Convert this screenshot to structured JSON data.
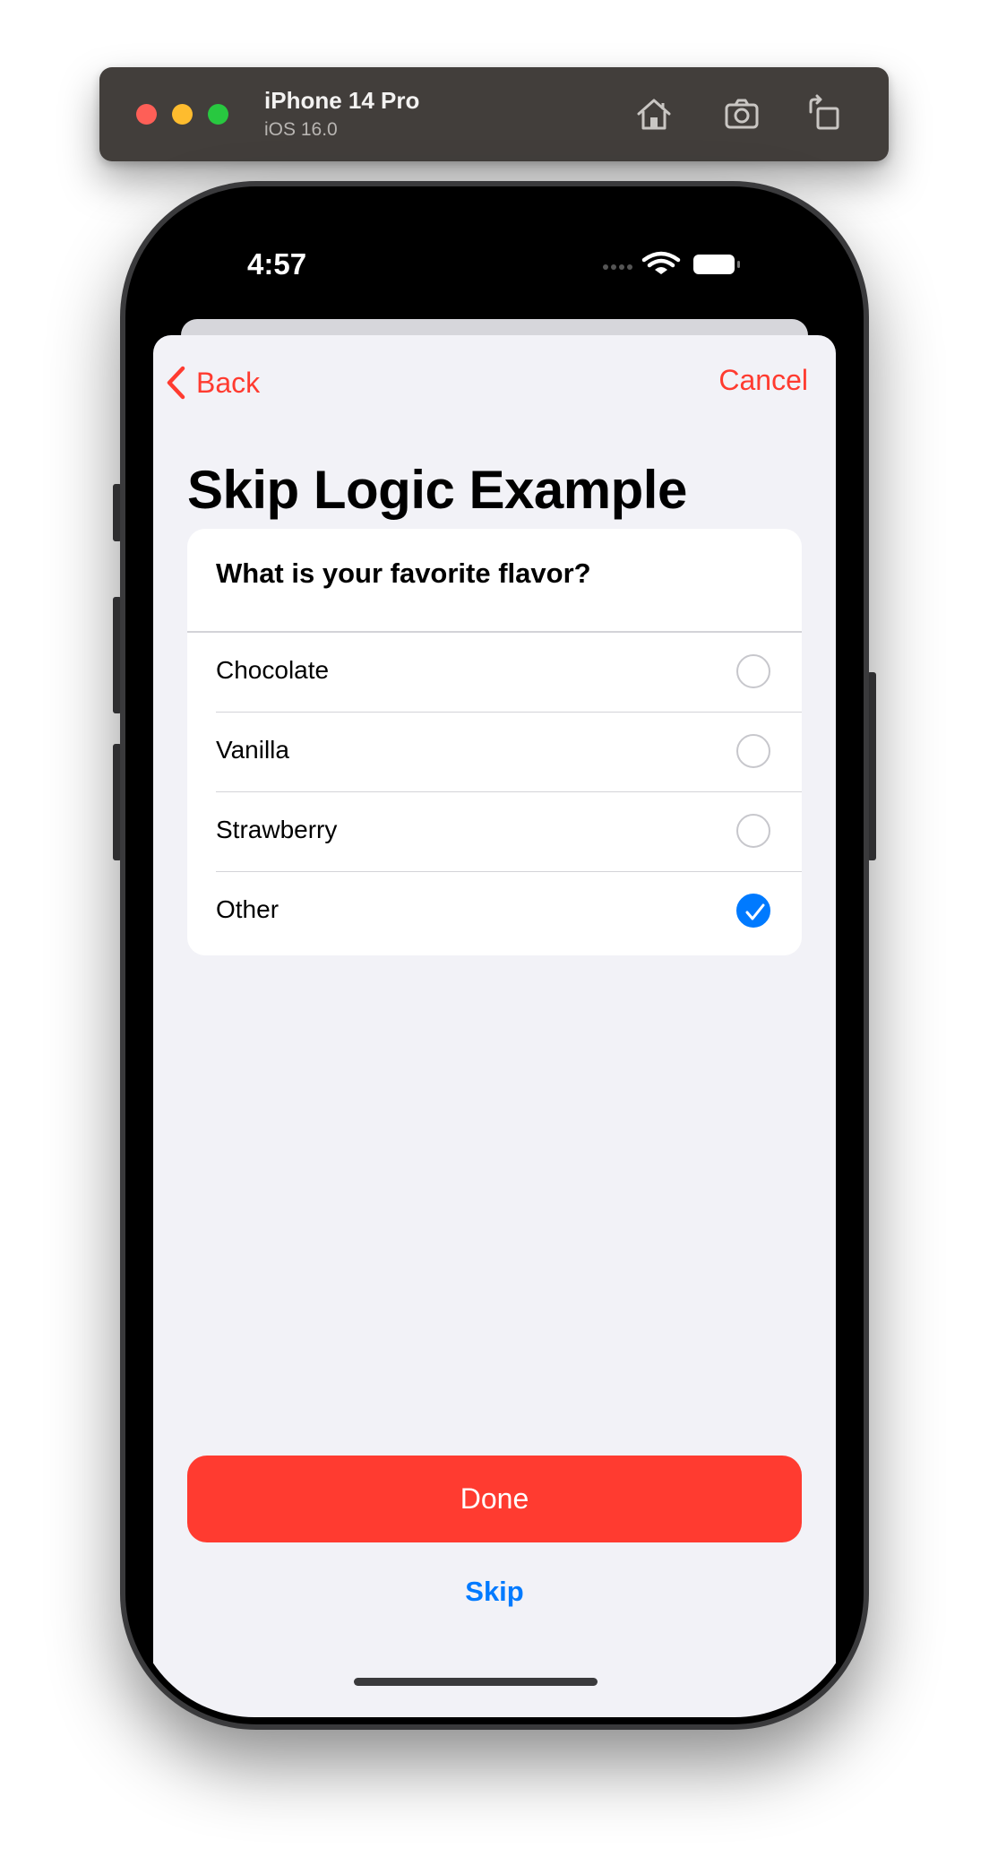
{
  "simulator": {
    "device_name": "iPhone 14 Pro",
    "os_version": "iOS 16.0",
    "toolbar_icons": [
      "home-icon",
      "screenshot-icon",
      "rotate-icon"
    ]
  },
  "status_bar": {
    "time": "4:57",
    "icons": [
      "signal-dots-icon",
      "wifi-icon",
      "battery-icon"
    ]
  },
  "nav": {
    "back_label": "Back",
    "cancel_label": "Cancel"
  },
  "page": {
    "title": "Skip Logic Example"
  },
  "question": {
    "text": "What is your favorite flavor?",
    "options": [
      {
        "label": "Chocolate",
        "selected": false
      },
      {
        "label": "Vanilla",
        "selected": false
      },
      {
        "label": "Strawberry",
        "selected": false
      },
      {
        "label": "Other",
        "selected": true
      }
    ]
  },
  "actions": {
    "done_label": "Done",
    "skip_label": "Skip"
  },
  "colors": {
    "accent_red": "#ff3b30",
    "accent_blue": "#007aff",
    "background": "#f2f2f7"
  }
}
